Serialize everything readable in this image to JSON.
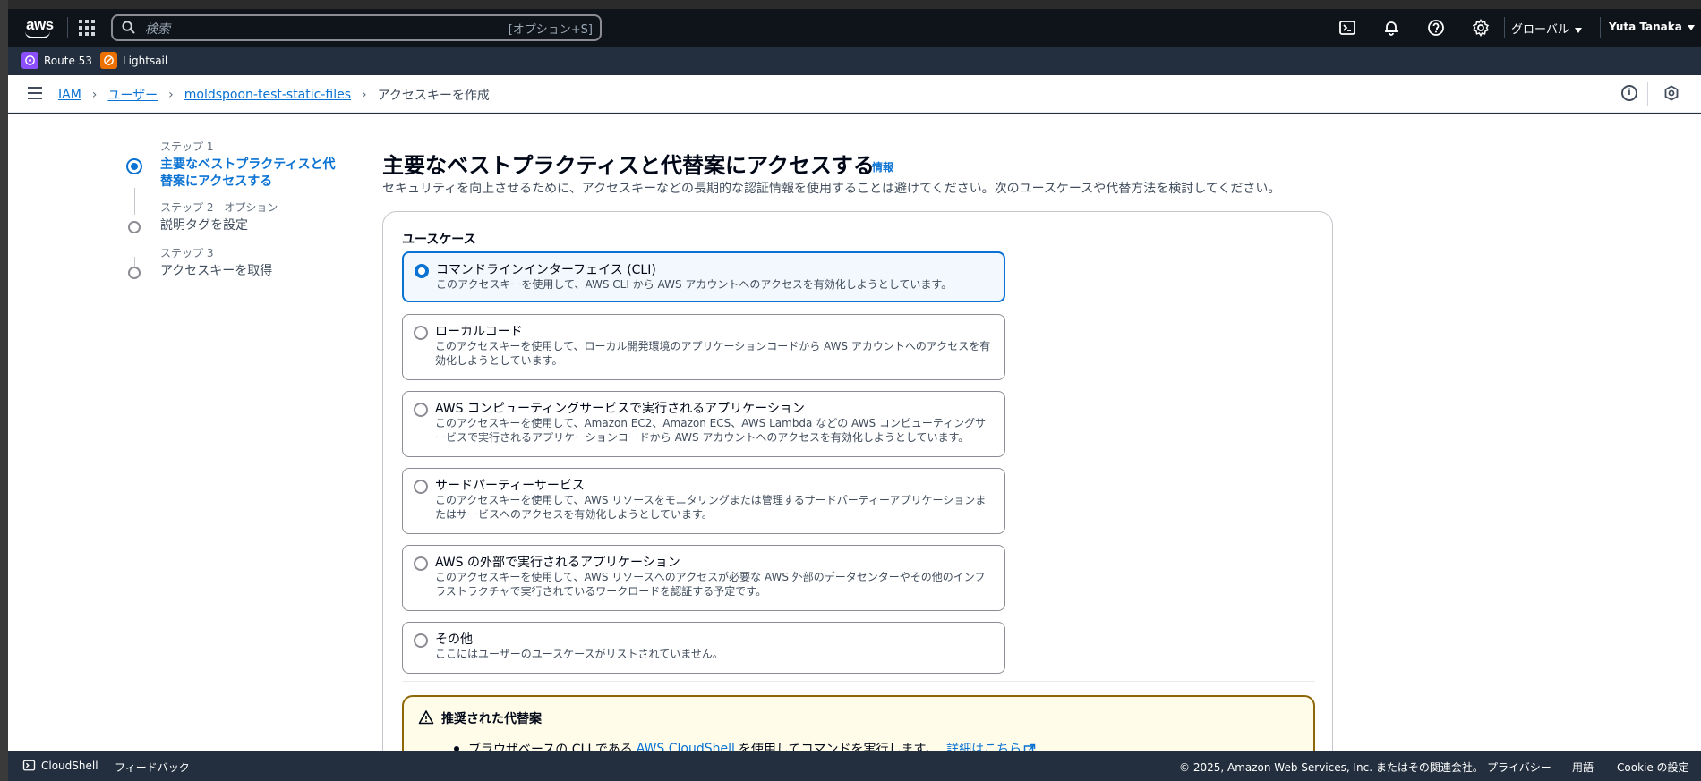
{
  "topnav": {
    "logo_text": "aws",
    "search_placeholder": "検索",
    "search_shortcut": "[オプション+S]",
    "region": "グローバル",
    "user": "Yuta Tanaka",
    "icons": [
      "cloudshell-icon",
      "bell-icon",
      "help-icon",
      "gear-icon"
    ]
  },
  "favorites": [
    {
      "label": "Route 53",
      "color": "#8c4fff"
    },
    {
      "label": "Lightsail",
      "color": "#ed7100"
    }
  ],
  "breadcrumb": {
    "items": [
      "IAM",
      "ユーザー",
      "moldspoon-test-static-files"
    ],
    "current": "アクセスキーを作成"
  },
  "steps": [
    {
      "label": "ステップ 1",
      "title": "主要なベストプラクティスと代替案にアクセスする",
      "active": true
    },
    {
      "label": "ステップ 2 - オプション",
      "title": "説明タグを設定",
      "active": false
    },
    {
      "label": "ステップ 3",
      "title": "アクセスキーを取得",
      "active": false
    }
  ],
  "main": {
    "title": "主要なベストプラクティスと代替案にアクセスする",
    "info_link": "情報",
    "description": "セキュリティを向上させるために、アクセスキーなどの長期的な認証情報を使用することは避けてください。次のユースケースや代替方法を検討してください。",
    "usecase_label": "ユースケース",
    "options": [
      {
        "title": "コマンドラインインターフェイス (CLI)",
        "desc": "このアクセスキーを使用して、AWS CLI から AWS アカウントへのアクセスを有効化しようとしています。",
        "selected": true
      },
      {
        "title": "ローカルコード",
        "desc": "このアクセスキーを使用して、ローカル開発環境のアプリケーションコードから AWS アカウントへのアクセスを有効化しようとしています。",
        "selected": false
      },
      {
        "title": "AWS コンピューティングサービスで実行されるアプリケーション",
        "desc": "このアクセスキーを使用して、Amazon EC2、Amazon ECS、AWS Lambda などの AWS コンピューティングサービスで実行されるアプリケーションコードから AWS アカウントへのアクセスを有効化しようとしています。",
        "selected": false
      },
      {
        "title": "サードパーティーサービス",
        "desc": "このアクセスキーを使用して、AWS リソースをモニタリングまたは管理するサードパーティーアプリケーションまたはサービスへのアクセスを有効化しようとしています。",
        "selected": false
      },
      {
        "title": "AWS の外部で実行されるアプリケーション",
        "desc": "このアクセスキーを使用して、AWS リソースへのアクセスが必要な AWS 外部のデータセンターやその他のインフラストラクチャで実行されているワークロードを認証する予定です。",
        "selected": false
      },
      {
        "title": "その他",
        "desc": "ここにはユーザーのユースケースがリストされていません。",
        "selected": false
      }
    ],
    "alert": {
      "title": "推奨された代替案",
      "item_prefix": "ブラウザベースの CLI である",
      "item_link": "AWS CloudShell",
      "item_suffix": "を使用してコマンドを実行します。",
      "learn_more": "詳細はこちら"
    }
  },
  "footer": {
    "cloudshell": "CloudShell",
    "feedback": "フィードバック",
    "copyright": "© 2025, Amazon Web Services, Inc. またはその関連会社。",
    "privacy": "プライバシー",
    "terms": "用語",
    "cookie": "Cookie の設定"
  }
}
